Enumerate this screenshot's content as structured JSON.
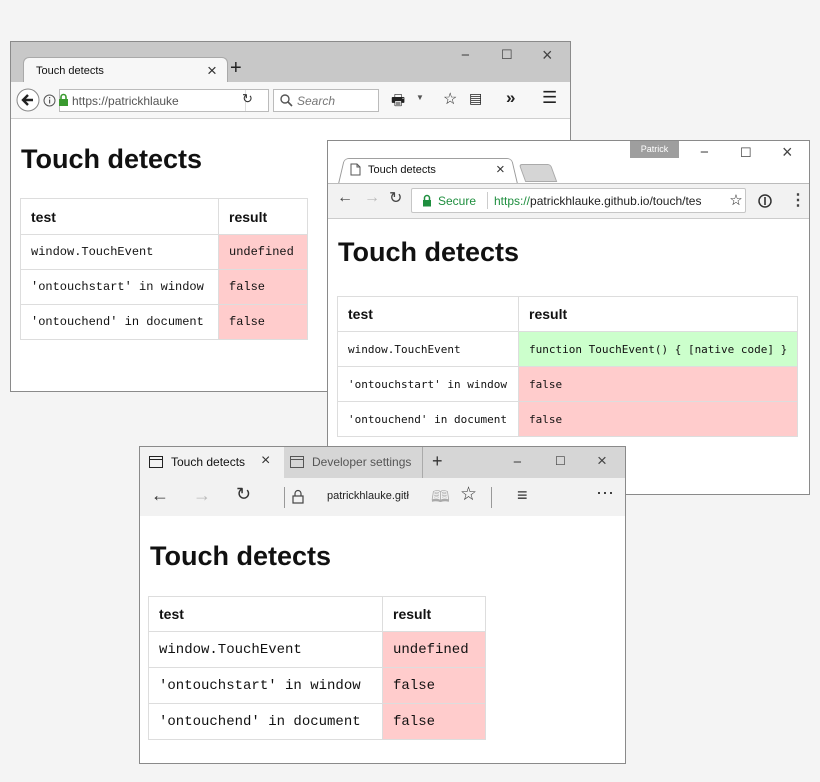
{
  "firefox": {
    "tab_title": "Touch detects",
    "url": "https://patrickhlauke",
    "search_placeholder": "Search",
    "page_title": "Touch detects",
    "table": {
      "headers": [
        "test",
        "result"
      ],
      "rows": [
        [
          "window.TouchEvent",
          "undefined"
        ],
        [
          "'ontouchstart' in window",
          "false"
        ],
        [
          "'ontouchend' in document",
          "false"
        ]
      ]
    }
  },
  "chrome": {
    "tab_title": "Touch detects",
    "profile": "Patrick",
    "secure_label": "Secure",
    "url_scheme": "https://",
    "url_rest": "patrickhlauke.github.io/touch/tes",
    "page_title": "Touch detects",
    "table": {
      "headers": [
        "test",
        "result"
      ],
      "rows": [
        [
          "window.TouchEvent",
          "function TouchEvent() { [native code] }"
        ],
        [
          "'ontouchstart' in window",
          "false"
        ],
        [
          "'ontouchend' in document",
          "false"
        ]
      ]
    }
  },
  "edge": {
    "tab1_title": "Touch detects",
    "tab2_title": "Developer settings",
    "url": "patrickhlauke.gitł",
    "page_title": "Touch detects",
    "table": {
      "headers": [
        "test",
        "result"
      ],
      "rows": [
        [
          "window.TouchEvent",
          "undefined"
        ],
        [
          "'ontouchstart' in window",
          "false"
        ],
        [
          "'ontouchend' in document",
          "false"
        ]
      ]
    }
  },
  "colors": {
    "fail": "#ffcccc",
    "pass": "#ccffcc",
    "secure_green": "#1e8e3e",
    "lock_green": "#3a9a2f"
  }
}
